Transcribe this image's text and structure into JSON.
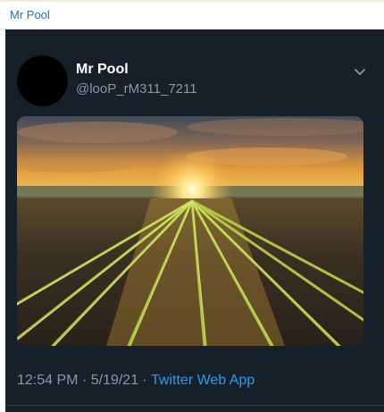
{
  "window": {
    "title": "Mr Pool"
  },
  "tweet": {
    "author_name": "Mr Pool",
    "author_handle": "@looP_rM311_7211",
    "time": "12:54 PM",
    "separator_1": " · ",
    "date": "5/19/21",
    "separator_2": " · ",
    "source": "Twitter Web App",
    "menu_icon": "chevron-down-icon"
  },
  "colors": {
    "background": "#15202b",
    "link": "#1da1f2",
    "secondary_text": "#8899a6"
  }
}
